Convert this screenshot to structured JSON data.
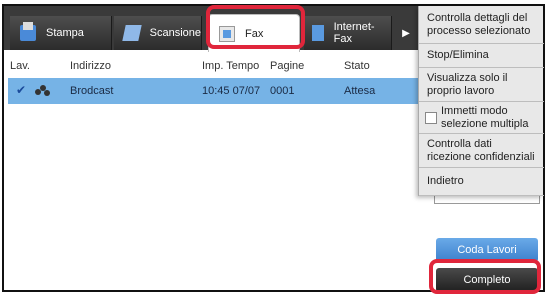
{
  "tabs": [
    {
      "label": "Stampa",
      "icon": "printer-icon"
    },
    {
      "label": "Scansione",
      "icon": "scanner-icon"
    },
    {
      "label": "Fax",
      "icon": "fax-icon",
      "selected": true
    },
    {
      "label": "Internet-Fax",
      "icon": "internet-fax-icon"
    }
  ],
  "tab_more_glyph": "▶",
  "table": {
    "headers": [
      "Lav.",
      "Indirizzo",
      "Imp. Tempo",
      "Pagine",
      "Stato"
    ],
    "rows": [
      {
        "selected": true,
        "check": "✔",
        "address": "Brodcast",
        "time": "10:45 07/07",
        "pages": "0001",
        "status": "Attesa"
      }
    ]
  },
  "menu": {
    "items": [
      "Controlla dettagli del processo selezionato",
      "Stop/Elimina",
      "Visualizza solo il proprio lavoro",
      "Immetti modo selezione multipla",
      "Controlla dati ricezione confidenziali",
      "Indietro"
    ]
  },
  "buttons": {
    "coda": "Coda Lavori",
    "completo": "Completo"
  },
  "colors": {
    "highlight": "#e0263b",
    "row_selected": "#76b3e6",
    "button_blue": "#3c80cc",
    "tabbar": "#3a3a3a"
  }
}
